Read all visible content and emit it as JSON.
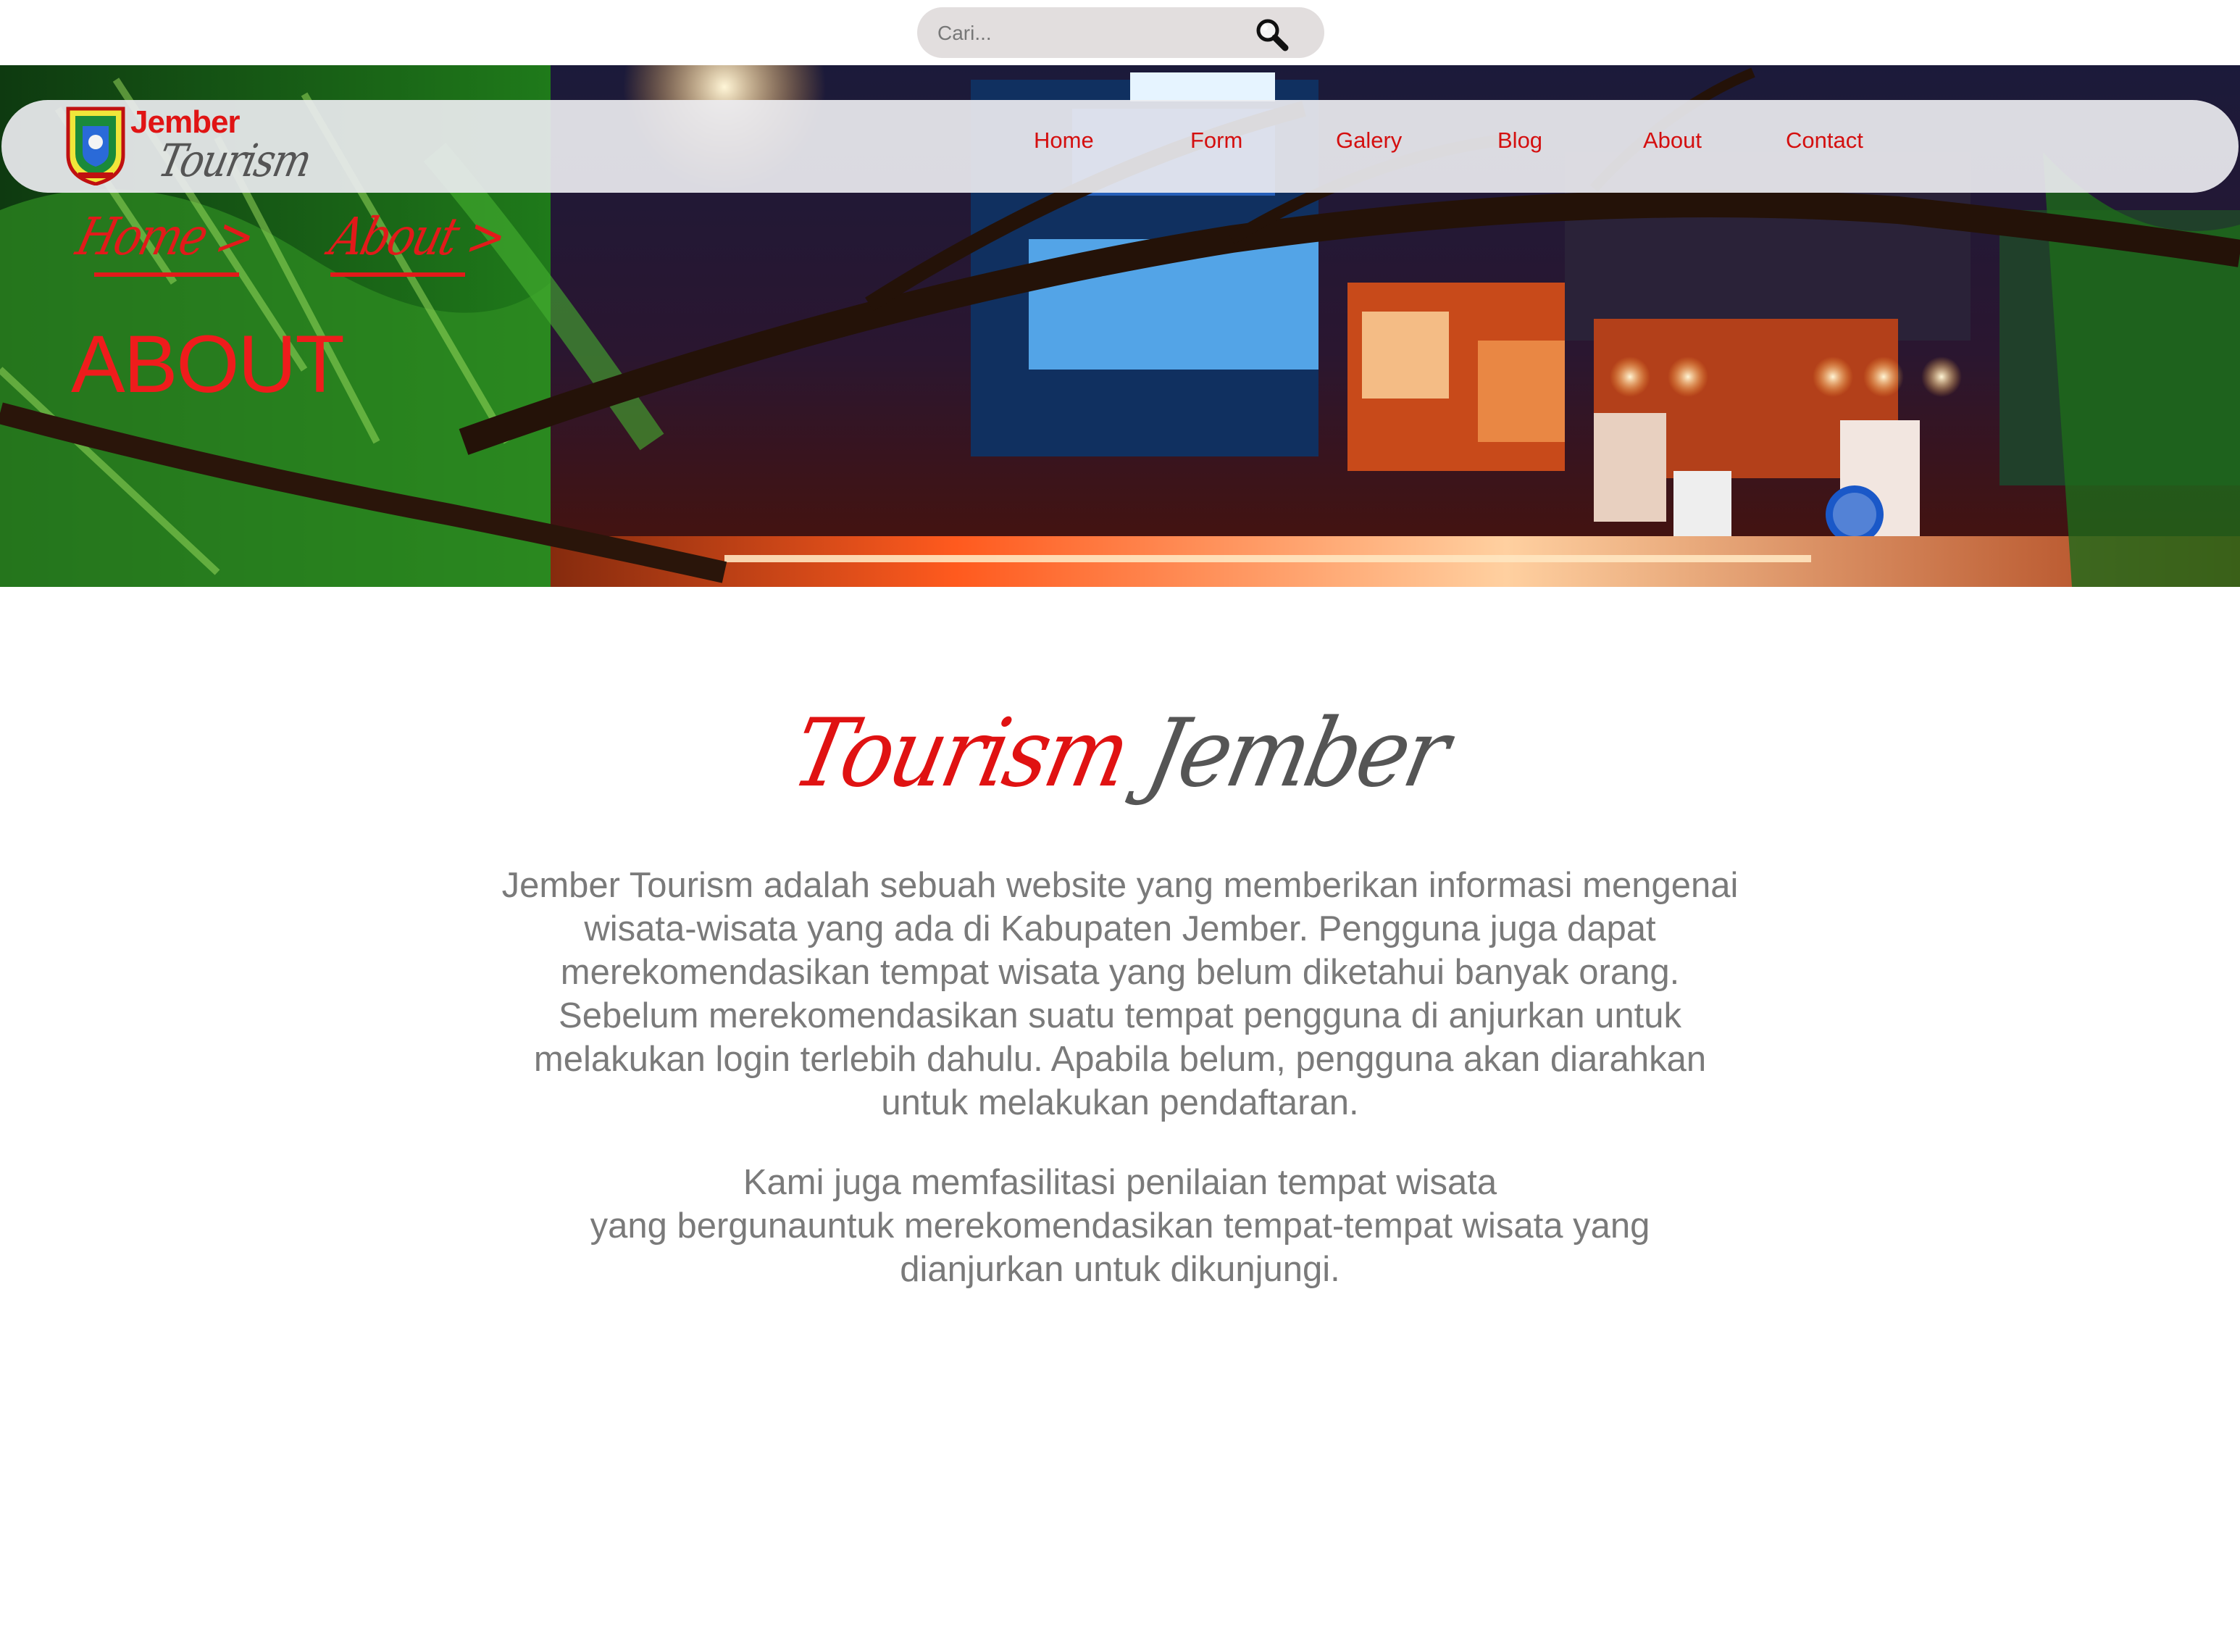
{
  "search": {
    "placeholder": "Cari..."
  },
  "brand": {
    "line1": "Jember",
    "line2": "Tourism"
  },
  "nav": {
    "items": [
      {
        "label": "Home"
      },
      {
        "label": "Form"
      },
      {
        "label": "Galery"
      },
      {
        "label": "Blog"
      },
      {
        "label": "About"
      },
      {
        "label": "Contact"
      }
    ]
  },
  "breadcrumb": [
    {
      "label": "Home >"
    },
    {
      "label": "About >"
    }
  ],
  "hero": {
    "title": "ABOUT"
  },
  "content": {
    "heading_red": "Tourism",
    "heading_grey": "Jember",
    "paragraph1": "Jember Tourism adalah sebuah website yang memberikan informasi mengenai\nwisata-wisata yang ada di Kabupaten Jember. Pengguna juga dapat\nmerekomendasikan tempat wisata yang belum diketahui banyak orang.\nSebelum merekomendasikan suatu tempat pengguna di anjurkan untuk\nmelakukan login terlebih dahulu. Apabila belum, pengguna akan diarahkan\nuntuk melakukan pendaftaran.",
    "paragraph2": "Kami juga memfasilitasi penilaian tempat wisata\nyang bergunauntuk merekomendasikan tempat-tempat wisata yang\ndianjurkan untuk dikunjungi."
  },
  "colors": {
    "accent": "#e01212",
    "text_grey": "#7a7a7a",
    "nav_bg": "#ececf0",
    "search_bg": "#e2dede"
  }
}
